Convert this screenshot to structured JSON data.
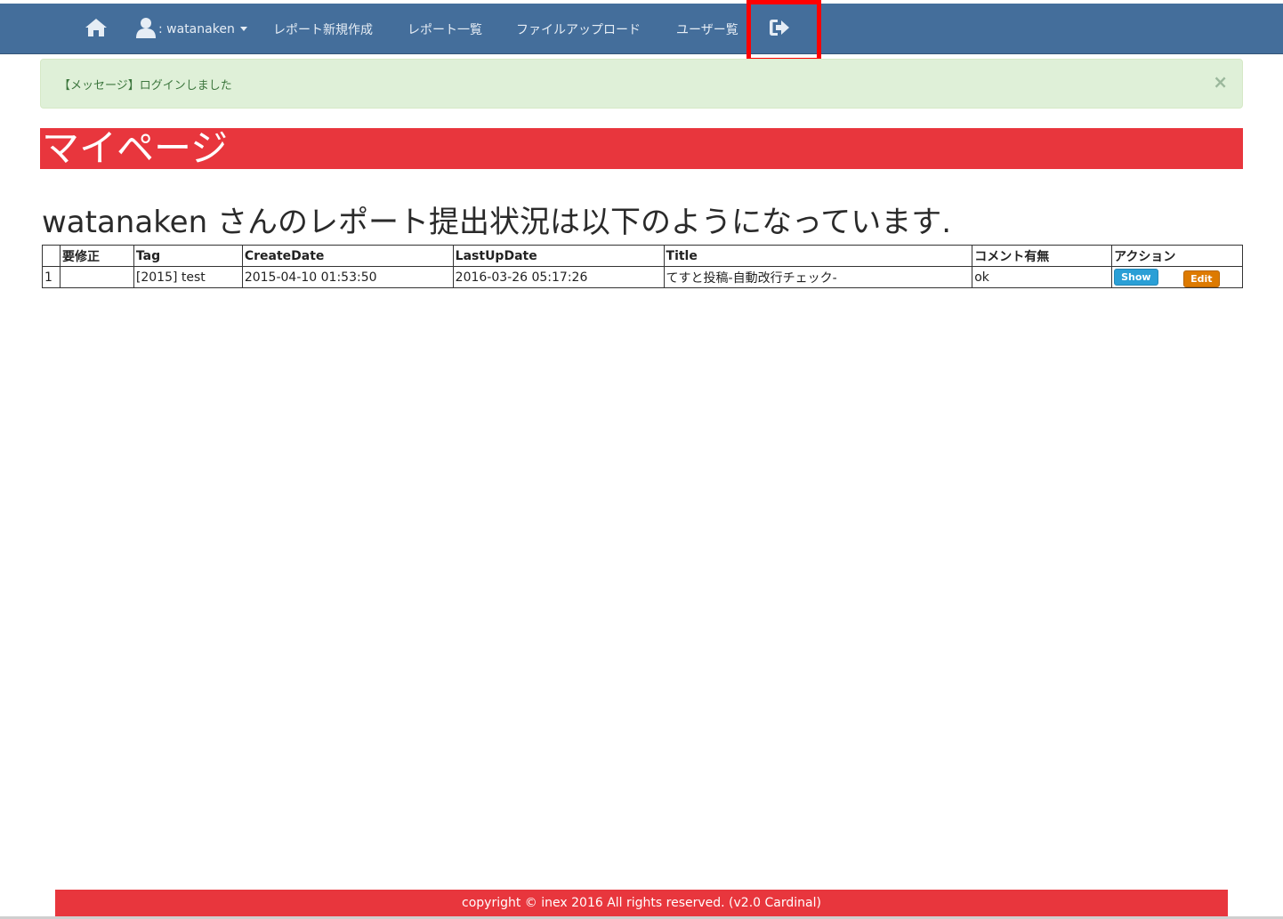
{
  "navbar": {
    "home_icon": "home-icon",
    "user_icon": "user-icon",
    "user_label": ": watanaken",
    "new_report": "レポート新規作成",
    "report_list": "レポート一覧",
    "file_upload": "ファイルアップロード",
    "user_list": "ユーザー覧",
    "logout_icon": "sign-out-icon",
    "bg_color": "#446e9b"
  },
  "alert": {
    "message": "【メッセージ】ログインしました",
    "close": "×"
  },
  "page": {
    "title": "マイページ",
    "status_heading": "watanaken さんのレポート提出状況は以下のようになっています.",
    "accent_color": "#e8363d"
  },
  "table": {
    "headers": [
      "",
      "要修正",
      "Tag",
      "CreateDate",
      "LastUpDate",
      "Title",
      "コメント有無",
      "アクション"
    ],
    "rows": [
      {
        "no": "1",
        "needs_fix": "",
        "tag": "[2015] test",
        "create_date": "2015-04-10 01:53:50",
        "last_update": "2016-03-26 05:17:26",
        "title": "てすと投稿-自動改行チェック-",
        "comment": "ok",
        "show_label": "Show",
        "edit_label": "Edit"
      }
    ]
  },
  "footer": {
    "text": "copyright © inex 2016 All rights reserved. (v2.0 Cardinal)"
  }
}
